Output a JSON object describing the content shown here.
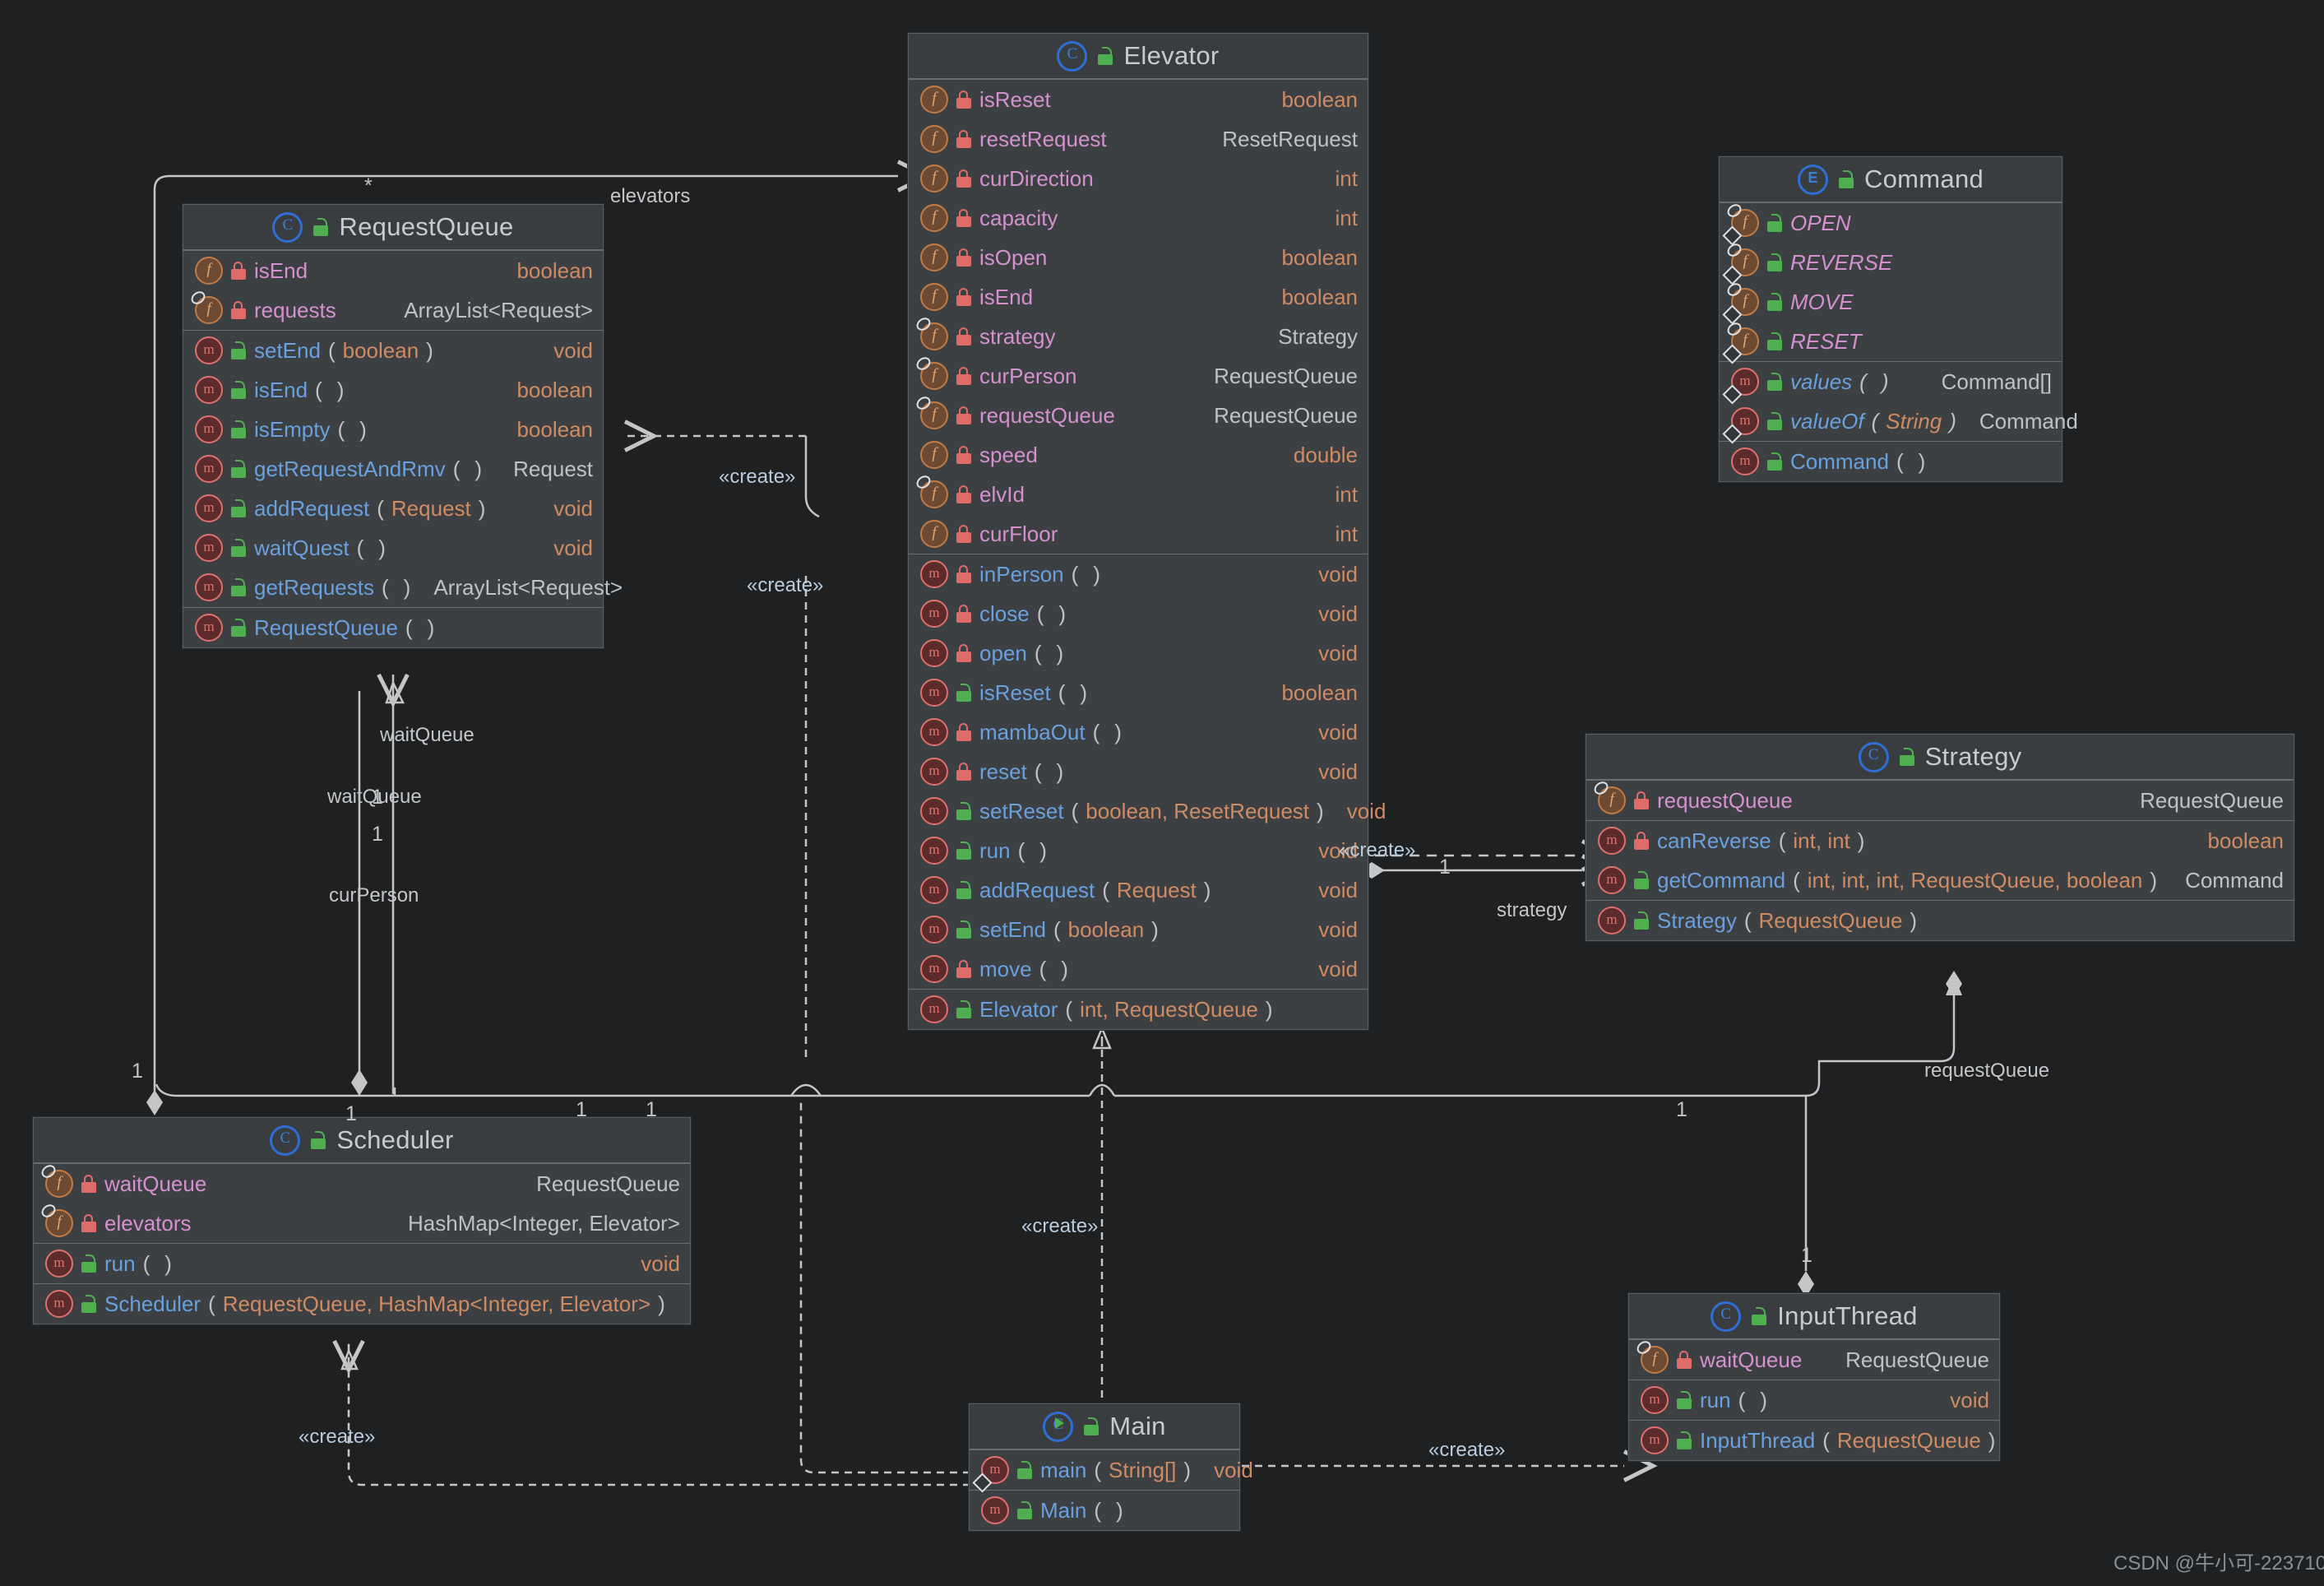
{
  "diagram": {
    "kind": "uml-class-diagram",
    "watermark": "CSDN @牛小可-22371010",
    "colors": {
      "canvas_bg": "#1e2022",
      "class_body_bg": "#3c4043",
      "class_header_bg": "#3a3d3f",
      "border": "#5a5d5f",
      "field_name": "#d491cd",
      "method_name": "#6aa0dd",
      "primitive_type": "#cf8b63",
      "object_type": "#bfc2c4",
      "edge": "#c3c5c7",
      "stereotype": "#b8cde0"
    }
  },
  "classes": {
    "elevator": {
      "name": "Elevator",
      "icon": "class-icon",
      "visibility_icon": "unlock-icon",
      "fields": [
        {
          "icon": "field-icon",
          "lock": "private",
          "name": "isReset",
          "type": "boolean",
          "type_kind": "prim",
          "final": false
        },
        {
          "icon": "field-icon",
          "lock": "private",
          "name": "resetRequest",
          "type": "ResetRequest",
          "type_kind": "obj",
          "final": false
        },
        {
          "icon": "field-icon",
          "lock": "private",
          "name": "curDirection",
          "type": "int",
          "type_kind": "prim",
          "final": false
        },
        {
          "icon": "field-icon",
          "lock": "private",
          "name": "capacity",
          "type": "int",
          "type_kind": "prim",
          "final": false
        },
        {
          "icon": "field-icon",
          "lock": "private",
          "name": "isOpen",
          "type": "boolean",
          "type_kind": "prim",
          "final": false
        },
        {
          "icon": "field-icon",
          "lock": "private",
          "name": "isEnd",
          "type": "boolean",
          "type_kind": "prim",
          "final": false
        },
        {
          "icon": "field-icon",
          "lock": "private",
          "name": "strategy",
          "type": "Strategy",
          "type_kind": "obj",
          "final": true
        },
        {
          "icon": "field-icon",
          "lock": "private",
          "name": "curPerson",
          "type": "RequestQueue",
          "type_kind": "obj",
          "final": true
        },
        {
          "icon": "field-icon",
          "lock": "private",
          "name": "requestQueue",
          "type": "RequestQueue",
          "type_kind": "obj",
          "final": true
        },
        {
          "icon": "field-icon",
          "lock": "private",
          "name": "speed",
          "type": "double",
          "type_kind": "prim",
          "final": false
        },
        {
          "icon": "field-icon",
          "lock": "private",
          "name": "elvId",
          "type": "int",
          "type_kind": "prim",
          "final": true
        },
        {
          "icon": "field-icon",
          "lock": "private",
          "name": "curFloor",
          "type": "int",
          "type_kind": "prim",
          "final": false
        }
      ],
      "methods": [
        {
          "icon": "method-icon",
          "lock": "private",
          "name": "inPerson",
          "args": "",
          "type": "void",
          "type_kind": "prim"
        },
        {
          "icon": "method-icon",
          "lock": "private",
          "name": "close",
          "args": "",
          "type": "void",
          "type_kind": "prim"
        },
        {
          "icon": "method-icon",
          "lock": "private",
          "name": "open",
          "args": "",
          "type": "void",
          "type_kind": "prim"
        },
        {
          "icon": "method-icon",
          "lock": "public",
          "name": "isReset",
          "args": "",
          "type": "boolean",
          "type_kind": "prim"
        },
        {
          "icon": "method-icon",
          "lock": "private",
          "name": "mambaOut",
          "args": "",
          "type": "void",
          "type_kind": "prim"
        },
        {
          "icon": "method-icon",
          "lock": "private",
          "name": "reset",
          "args": "",
          "type": "void",
          "type_kind": "prim"
        },
        {
          "icon": "method-icon",
          "lock": "public",
          "name": "setReset",
          "args": "boolean, ResetRequest",
          "type": "void",
          "type_kind": "prim"
        },
        {
          "icon": "method-icon",
          "lock": "public",
          "name": "run",
          "args": "",
          "type": "void",
          "type_kind": "prim"
        },
        {
          "icon": "method-icon",
          "lock": "public",
          "name": "addRequest",
          "args": "Request",
          "type": "void",
          "type_kind": "prim"
        },
        {
          "icon": "method-icon",
          "lock": "public",
          "name": "setEnd",
          "args": "boolean",
          "type": "void",
          "type_kind": "prim"
        },
        {
          "icon": "method-icon",
          "lock": "private",
          "name": "move",
          "args": "",
          "type": "void",
          "type_kind": "prim"
        }
      ],
      "constructors": [
        {
          "icon": "method-icon",
          "lock": "public",
          "name": "Elevator",
          "args": "int, RequestQueue",
          "type": "",
          "type_kind": "obj"
        }
      ]
    },
    "request_queue": {
      "name": "RequestQueue",
      "icon": "class-icon",
      "visibility_icon": "unlock-icon",
      "fields": [
        {
          "icon": "field-icon",
          "lock": "private",
          "name": "isEnd",
          "type": "boolean",
          "type_kind": "prim",
          "final": false
        },
        {
          "icon": "field-icon",
          "lock": "private",
          "name": "requests",
          "type": "ArrayList<Request>",
          "type_kind": "obj",
          "final": true
        }
      ],
      "methods": [
        {
          "icon": "method-icon",
          "lock": "public",
          "name": "setEnd",
          "args": "boolean",
          "type": "void",
          "type_kind": "prim"
        },
        {
          "icon": "method-icon",
          "lock": "public",
          "name": "isEnd",
          "args": "",
          "type": "boolean",
          "type_kind": "prim"
        },
        {
          "icon": "method-icon",
          "lock": "public",
          "name": "isEmpty",
          "args": "",
          "type": "boolean",
          "type_kind": "prim"
        },
        {
          "icon": "method-icon",
          "lock": "public",
          "name": "getRequestAndRmv",
          "args": "",
          "type": "Request",
          "type_kind": "obj"
        },
        {
          "icon": "method-icon",
          "lock": "public",
          "name": "addRequest",
          "args": "Request",
          "type": "void",
          "type_kind": "prim"
        },
        {
          "icon": "method-icon",
          "lock": "public",
          "name": "waitQuest",
          "args": "",
          "type": "void",
          "type_kind": "prim"
        },
        {
          "icon": "method-icon",
          "lock": "public",
          "name": "getRequests",
          "args": "",
          "type": "ArrayList<Request>",
          "type_kind": "obj"
        }
      ],
      "constructors": [
        {
          "icon": "method-icon",
          "lock": "public",
          "name": "RequestQueue",
          "args": "",
          "type": "",
          "type_kind": "obj"
        }
      ]
    },
    "command": {
      "name": "Command",
      "icon": "enum-icon",
      "visibility_icon": "unlock-icon",
      "constants": [
        {
          "icon": "enum-const-icon",
          "lock": "public",
          "name": "OPEN"
        },
        {
          "icon": "enum-const-icon",
          "lock": "public",
          "name": "REVERSE"
        },
        {
          "icon": "enum-const-icon",
          "lock": "public",
          "name": "MOVE"
        },
        {
          "icon": "enum-const-icon",
          "lock": "public",
          "name": "RESET"
        }
      ],
      "methods": [
        {
          "icon": "static-method-icon",
          "lock": "public",
          "name": "values",
          "args": "",
          "type": "Command[]",
          "type_kind": "obj"
        },
        {
          "icon": "static-method-icon",
          "lock": "public",
          "name": "valueOf",
          "args": "String",
          "type": "Command",
          "type_kind": "obj"
        }
      ],
      "constructors": [
        {
          "icon": "method-icon",
          "lock": "public",
          "name": "Command",
          "args": "",
          "type": "",
          "type_kind": "obj"
        }
      ]
    },
    "strategy": {
      "name": "Strategy",
      "icon": "class-icon",
      "visibility_icon": "unlock-icon",
      "fields": [
        {
          "icon": "field-icon",
          "lock": "private",
          "name": "requestQueue",
          "type": "RequestQueue",
          "type_kind": "obj",
          "final": true
        }
      ],
      "methods": [
        {
          "icon": "method-icon",
          "lock": "private",
          "name": "canReverse",
          "args": "int, int",
          "type": "boolean",
          "type_kind": "prim"
        },
        {
          "icon": "method-icon",
          "lock": "public",
          "name": "getCommand",
          "args": "int, int, int, RequestQueue, boolean",
          "type": "Command",
          "type_kind": "obj"
        }
      ],
      "constructors": [
        {
          "icon": "method-icon",
          "lock": "public",
          "name": "Strategy",
          "args": "RequestQueue",
          "type": "",
          "type_kind": "obj"
        }
      ]
    },
    "scheduler": {
      "name": "Scheduler",
      "icon": "class-icon",
      "visibility_icon": "unlock-icon",
      "fields": [
        {
          "icon": "field-icon",
          "lock": "private",
          "name": "waitQueue",
          "type": "RequestQueue",
          "type_kind": "obj",
          "final": true
        },
        {
          "icon": "field-icon",
          "lock": "private",
          "name": "elevators",
          "type": "HashMap<Integer, Elevator>",
          "type_kind": "obj",
          "final": true
        }
      ],
      "methods": [
        {
          "icon": "method-icon",
          "lock": "public",
          "name": "run",
          "args": "",
          "type": "void",
          "type_kind": "prim"
        }
      ],
      "constructors": [
        {
          "icon": "method-icon",
          "lock": "public",
          "name": "Scheduler",
          "args": "RequestQueue, HashMap<Integer, Elevator>",
          "type": "",
          "type_kind": "obj"
        }
      ]
    },
    "input_thread": {
      "name": "InputThread",
      "icon": "class-icon",
      "visibility_icon": "unlock-icon",
      "fields": [
        {
          "icon": "field-icon",
          "lock": "private",
          "name": "waitQueue",
          "type": "RequestQueue",
          "type_kind": "obj",
          "final": true
        }
      ],
      "methods": [
        {
          "icon": "method-icon",
          "lock": "public",
          "name": "run",
          "args": "",
          "type": "void",
          "type_kind": "prim"
        }
      ],
      "constructors": [
        {
          "icon": "method-icon",
          "lock": "public",
          "name": "InputThread",
          "args": "RequestQueue",
          "type": "",
          "type_kind": "obj"
        }
      ]
    },
    "main": {
      "name": "Main",
      "icon": "runnable-class-icon",
      "visibility_icon": "unlock-icon",
      "methods": [
        {
          "icon": "static-method-icon",
          "lock": "public",
          "name": "main",
          "args": "String[]",
          "type": "void",
          "type_kind": "prim"
        }
      ],
      "constructors": [
        {
          "icon": "method-icon",
          "lock": "public",
          "name": "Main",
          "args": "",
          "type": "",
          "type_kind": "obj"
        }
      ]
    }
  },
  "edge_labels": [
    {
      "id": "elevators-role",
      "text": "elevators",
      "kind": "role"
    },
    {
      "id": "elevators-mult",
      "text": "*",
      "kind": "mult"
    },
    {
      "id": "create-1",
      "text": "«create»",
      "kind": "stereotype"
    },
    {
      "id": "create-2",
      "text": "«create»",
      "kind": "stereotype"
    },
    {
      "id": "create-3",
      "text": "«create»",
      "kind": "stereotype"
    },
    {
      "id": "create-4",
      "text": "«create»",
      "kind": "stereotype"
    },
    {
      "id": "create-5",
      "text": "«create»",
      "kind": "stereotype"
    },
    {
      "id": "waitqueue-1",
      "text": "waitQueue",
      "kind": "role"
    },
    {
      "id": "waitqueue-2",
      "text": "waitQueue",
      "kind": "role"
    },
    {
      "id": "curperson",
      "text": "curPerson",
      "kind": "role"
    },
    {
      "id": "strategy-role",
      "text": "strategy",
      "kind": "role"
    },
    {
      "id": "requestqueue-role",
      "text": "requestQueue",
      "kind": "role"
    },
    {
      "id": "m-left-1",
      "text": "1",
      "kind": "mult"
    },
    {
      "id": "m-rq-1",
      "text": "1",
      "kind": "mult"
    },
    {
      "id": "m-rq-2",
      "text": "1",
      "kind": "mult"
    },
    {
      "id": "m-sch-1",
      "text": "1",
      "kind": "mult"
    },
    {
      "id": "m-sch-2",
      "text": "1",
      "kind": "mult"
    },
    {
      "id": "m-sch-3",
      "text": "1",
      "kind": "mult"
    },
    {
      "id": "m-strat-1",
      "text": "1",
      "kind": "mult"
    },
    {
      "id": "m-it-1",
      "text": "1",
      "kind": "mult"
    },
    {
      "id": "m-it-2",
      "text": "1",
      "kind": "mult"
    }
  ]
}
